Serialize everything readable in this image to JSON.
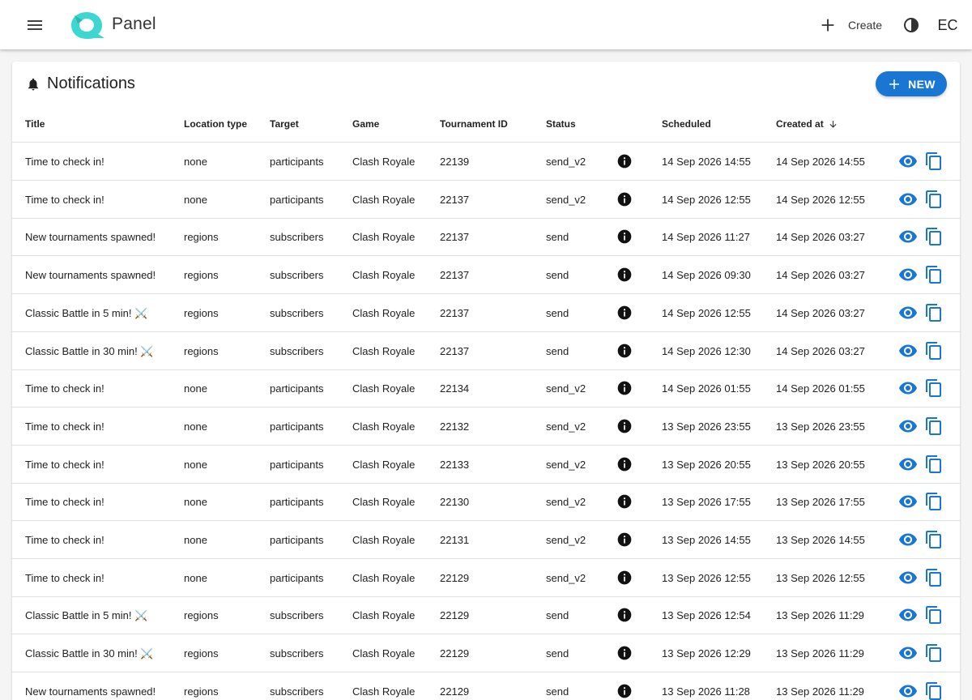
{
  "app": {
    "brand": "Panel",
    "create_label": "Create",
    "avatar_initials": "EC",
    "accent_color": "#1976d2",
    "logo_color": "#3dd6d0"
  },
  "page": {
    "title": "Notifications",
    "new_button_label": "NEW",
    "icons": {
      "menu": "menu-icon",
      "bell": "bell-icon",
      "create": "plus-icon",
      "theme": "contrast-icon",
      "sort": "arrow-down-icon",
      "info": "info-icon",
      "view": "eye-icon",
      "copy": "copy-icon"
    }
  },
  "table": {
    "columns": [
      {
        "key": "title",
        "label": "Title"
      },
      {
        "key": "location_type",
        "label": "Location type"
      },
      {
        "key": "target",
        "label": "Target"
      },
      {
        "key": "game",
        "label": "Game"
      },
      {
        "key": "tournament_id",
        "label": "Tournament ID"
      },
      {
        "key": "status",
        "label": "Status"
      },
      {
        "key": "info",
        "label": ""
      },
      {
        "key": "scheduled",
        "label": "Scheduled"
      },
      {
        "key": "created_at",
        "label": "Created at",
        "sort": "descending"
      }
    ],
    "rows": [
      {
        "title": "Time to check in!",
        "location_type": "none",
        "target": "participants",
        "game": "Clash Royale",
        "tournament_id": "22139",
        "status": "send_v2",
        "scheduled": "14 Sep 2026 14:55",
        "created_at": "14 Sep 2026 14:55"
      },
      {
        "title": "Time to check in!",
        "location_type": "none",
        "target": "participants",
        "game": "Clash Royale",
        "tournament_id": "22137",
        "status": "send_v2",
        "scheduled": "14 Sep 2026 12:55",
        "created_at": "14 Sep 2026 12:55"
      },
      {
        "title": "New tournaments spawned!",
        "location_type": "regions",
        "target": "subscribers",
        "game": "Clash Royale",
        "tournament_id": "22137",
        "status": "send",
        "scheduled": "14 Sep 2026 11:27",
        "created_at": "14 Sep 2026 03:27"
      },
      {
        "title": "New tournaments spawned!",
        "location_type": "regions",
        "target": "subscribers",
        "game": "Clash Royale",
        "tournament_id": "22137",
        "status": "send",
        "scheduled": "14 Sep 2026 09:30",
        "created_at": "14 Sep 2026 03:27"
      },
      {
        "title": "Classic Battle in 5 min! ⚔️",
        "location_type": "regions",
        "target": "subscribers",
        "game": "Clash Royale",
        "tournament_id": "22137",
        "status": "send",
        "scheduled": "14 Sep 2026 12:55",
        "created_at": "14 Sep 2026 03:27"
      },
      {
        "title": "Classic Battle in 30 min! ⚔️",
        "location_type": "regions",
        "target": "subscribers",
        "game": "Clash Royale",
        "tournament_id": "22137",
        "status": "send",
        "scheduled": "14 Sep 2026 12:30",
        "created_at": "14 Sep 2026 03:27"
      },
      {
        "title": "Time to check in!",
        "location_type": "none",
        "target": "participants",
        "game": "Clash Royale",
        "tournament_id": "22134",
        "status": "send_v2",
        "scheduled": "14 Sep 2026 01:55",
        "created_at": "14 Sep 2026 01:55"
      },
      {
        "title": "Time to check in!",
        "location_type": "none",
        "target": "participants",
        "game": "Clash Royale",
        "tournament_id": "22132",
        "status": "send_v2",
        "scheduled": "13 Sep 2026 23:55",
        "created_at": "13 Sep 2026 23:55"
      },
      {
        "title": "Time to check in!",
        "location_type": "none",
        "target": "participants",
        "game": "Clash Royale",
        "tournament_id": "22133",
        "status": "send_v2",
        "scheduled": "13 Sep 2026 20:55",
        "created_at": "13 Sep 2026 20:55"
      },
      {
        "title": "Time to check in!",
        "location_type": "none",
        "target": "participants",
        "game": "Clash Royale",
        "tournament_id": "22130",
        "status": "send_v2",
        "scheduled": "13 Sep 2026 17:55",
        "created_at": "13 Sep 2026 17:55"
      },
      {
        "title": "Time to check in!",
        "location_type": "none",
        "target": "participants",
        "game": "Clash Royale",
        "tournament_id": "22131",
        "status": "send_v2",
        "scheduled": "13 Sep 2026 14:55",
        "created_at": "13 Sep 2026 14:55"
      },
      {
        "title": "Time to check in!",
        "location_type": "none",
        "target": "participants",
        "game": "Clash Royale",
        "tournament_id": "22129",
        "status": "send_v2",
        "scheduled": "13 Sep 2026 12:55",
        "created_at": "13 Sep 2026 12:55"
      },
      {
        "title": "Classic Battle in 5 min! ⚔️",
        "location_type": "regions",
        "target": "subscribers",
        "game": "Clash Royale",
        "tournament_id": "22129",
        "status": "send",
        "scheduled": "13 Sep 2026 12:54",
        "created_at": "13 Sep 2026 11:29"
      },
      {
        "title": "Classic Battle in 30 min! ⚔️",
        "location_type": "regions",
        "target": "subscribers",
        "game": "Clash Royale",
        "tournament_id": "22129",
        "status": "send",
        "scheduled": "13 Sep 2026 12:29",
        "created_at": "13 Sep 2026 11:29"
      },
      {
        "title": "New tournaments spawned!",
        "location_type": "regions",
        "target": "subscribers",
        "game": "Clash Royale",
        "tournament_id": "22129",
        "status": "send",
        "scheduled": "13 Sep 2026 11:28",
        "created_at": "13 Sep 2026 11:29"
      }
    ]
  }
}
